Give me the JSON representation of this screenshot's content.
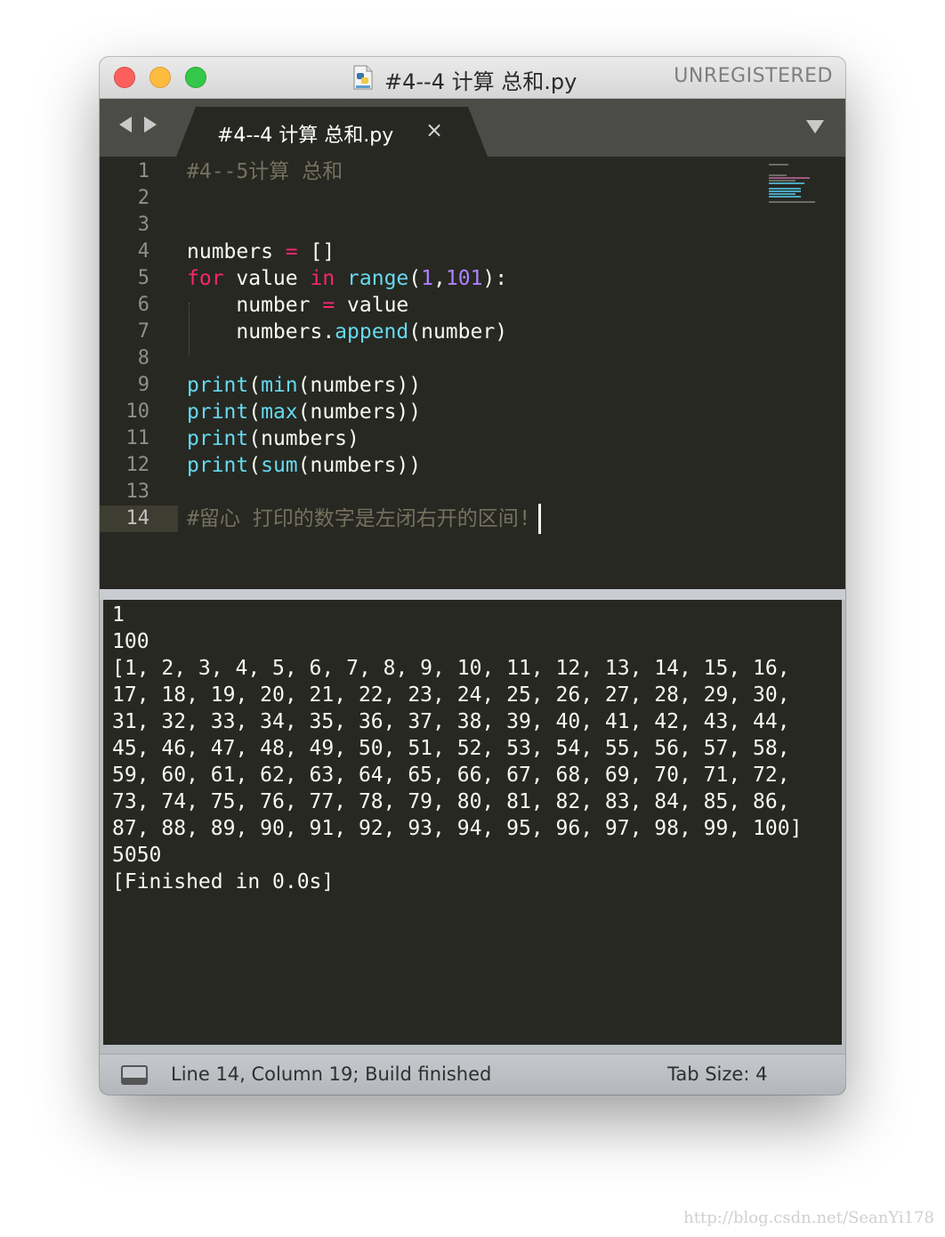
{
  "window": {
    "title": "#4--4 计算 总和.py",
    "license_status": "UNREGISTERED"
  },
  "tabs": [
    {
      "label": "#4--4 计算 总和.py",
      "close_glyph": "×",
      "active": true
    }
  ],
  "editor": {
    "active_line": 14,
    "line_numbers": [
      "1",
      "2",
      "3",
      "4",
      "5",
      "6",
      "7",
      "8",
      "9",
      "10",
      "11",
      "12",
      "13",
      "14"
    ],
    "lines": [
      [
        {
          "t": "#4--5计算 总和",
          "c": "cmt"
        }
      ],
      [],
      [],
      [
        {
          "t": "numbers ",
          "c": ""
        },
        {
          "t": "=",
          "c": "op"
        },
        {
          "t": " []",
          "c": ""
        }
      ],
      [
        {
          "t": "for",
          "c": "kw"
        },
        {
          "t": " value ",
          "c": ""
        },
        {
          "t": "in",
          "c": "kw"
        },
        {
          "t": " ",
          "c": ""
        },
        {
          "t": "range",
          "c": "fn"
        },
        {
          "t": "(",
          "c": ""
        },
        {
          "t": "1",
          "c": "num"
        },
        {
          "t": ",",
          "c": ""
        },
        {
          "t": "101",
          "c": "num"
        },
        {
          "t": "):",
          "c": ""
        }
      ],
      [
        {
          "t": "    number ",
          "c": ""
        },
        {
          "t": "=",
          "c": "op"
        },
        {
          "t": " value",
          "c": ""
        }
      ],
      [
        {
          "t": "    numbers.",
          "c": ""
        },
        {
          "t": "append",
          "c": "fn"
        },
        {
          "t": "(number)",
          "c": ""
        }
      ],
      [],
      [
        {
          "t": "print",
          "c": "fn"
        },
        {
          "t": "(",
          "c": ""
        },
        {
          "t": "min",
          "c": "fn"
        },
        {
          "t": "(numbers))",
          "c": ""
        }
      ],
      [
        {
          "t": "print",
          "c": "fn"
        },
        {
          "t": "(",
          "c": ""
        },
        {
          "t": "max",
          "c": "fn"
        },
        {
          "t": "(numbers))",
          "c": ""
        }
      ],
      [
        {
          "t": "print",
          "c": "fn"
        },
        {
          "t": "(numbers)",
          "c": ""
        }
      ],
      [
        {
          "t": "print",
          "c": "fn"
        },
        {
          "t": "(",
          "c": ""
        },
        {
          "t": "sum",
          "c": "fn"
        },
        {
          "t": "(numbers))",
          "c": ""
        }
      ],
      [],
      [
        {
          "t": "#留心 打印的数字是左闭右开的区间!",
          "c": "cmt"
        }
      ]
    ]
  },
  "output": {
    "lines": [
      "1",
      "100",
      "[1, 2, 3, 4, 5, 6, 7, 8, 9, 10, 11, 12, 13, 14, 15, 16,",
      "17, 18, 19, 20, 21, 22, 23, 24, 25, 26, 27, 28, 29, 30,",
      "31, 32, 33, 34, 35, 36, 37, 38, 39, 40, 41, 42, 43, 44,",
      "45, 46, 47, 48, 49, 50, 51, 52, 53, 54, 55, 56, 57, 58,",
      "59, 60, 61, 62, 63, 64, 65, 66, 67, 68, 69, 70, 71, 72,",
      "73, 74, 75, 76, 77, 78, 79, 80, 81, 82, 83, 84, 85, 86,",
      "87, 88, 89, 90, 91, 92, 93, 94, 95, 96, 97, 98, 99, 100]",
      "5050",
      "[Finished in 0.0s]"
    ]
  },
  "statusbar": {
    "position_text": "Line 14, Column 19; Build finished",
    "tab_size_text": "Tab Size: 4"
  },
  "watermark": "http://blog.csdn.net/SeanYi178",
  "colors": {
    "editor_bg": "#272822",
    "comment": "#75715e",
    "keyword": "#f92672",
    "function": "#66d9ef",
    "number": "#ae81ff",
    "text": "#f8f8f2"
  }
}
